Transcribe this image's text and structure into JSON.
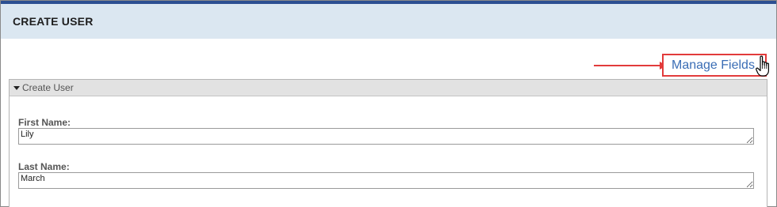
{
  "header": {
    "title": "CREATE USER"
  },
  "manage_fields": {
    "label": "Manage Fields"
  },
  "section": {
    "title": "Create User",
    "fields": [
      {
        "label": "First Name:",
        "value": "Lily"
      },
      {
        "label": "Last Name:",
        "value": "March"
      }
    ]
  },
  "colors": {
    "top_bar": "#2b4f92",
    "header_bg": "#dbe7f1",
    "highlight": "#e23b3b",
    "link": "#3a6db5"
  },
  "icons": {
    "cursor": "hand-pointer-icon",
    "arrow": "arrow-right-icon",
    "caret": "caret-down-icon"
  }
}
